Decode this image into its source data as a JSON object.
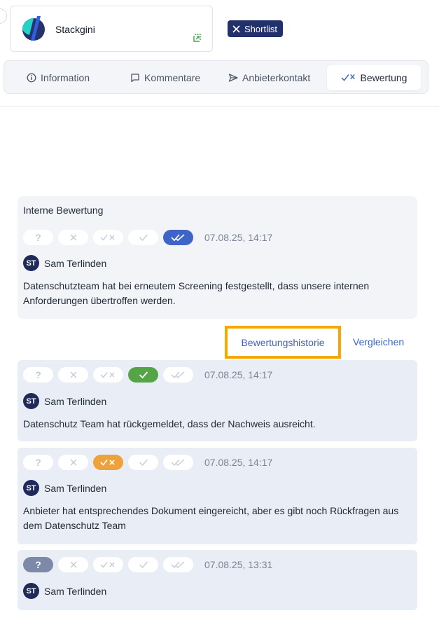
{
  "vendor": {
    "name": "Stackgini",
    "logo_icon": "stackgini-logo-icon",
    "corner_icon": "external-link-icon"
  },
  "shortlist_badge": {
    "label": "Shortlist",
    "icon": "close-icon"
  },
  "tabs": [
    {
      "label": "Information",
      "icon": "info-icon"
    },
    {
      "label": "Kommentare",
      "icon": "comment-icon"
    },
    {
      "label": "Anbieterkontakt",
      "icon": "send-icon"
    },
    {
      "label": "Bewertung",
      "icon": "check-x-icon",
      "active": true
    }
  ],
  "rating_scale": [
    "unknown",
    "rejected",
    "partially",
    "fulfilled",
    "exceeded"
  ],
  "internal_rating": {
    "title": "Interne Bewertung",
    "selected": "exceeded",
    "timestamp": "07.08.25, 14:17",
    "user": {
      "initials": "ST",
      "name": "Sam Terlinden"
    },
    "comment": "Datenschutzteam hat bei erneutem Screening festgestellt, dass unsere internen Anforderungen übertroffen werden."
  },
  "links": {
    "history": "Bewertungshistorie",
    "compare": "Vergleichen"
  },
  "history": [
    {
      "selected": "fulfilled",
      "timestamp": "07.08.25, 14:17",
      "user": {
        "initials": "ST",
        "name": "Sam Terlinden"
      },
      "comment": "Datenschutz Team hat rückgemeldet, dass der Nachweis ausreicht."
    },
    {
      "selected": "partially",
      "timestamp": "07.08.25, 14:17",
      "user": {
        "initials": "ST",
        "name": "Sam Terlinden"
      },
      "comment": "Anbieter hat entsprechendes Dokument eingereicht, aber es gibt noch Rückfragen aus dem Datenschutz Team"
    },
    {
      "selected": "unknown",
      "timestamp": "07.08.25, 13:31",
      "user": {
        "initials": "ST",
        "name": "Sam Terlinden"
      },
      "comment": ""
    }
  ],
  "colors": {
    "accent_blue": "#3f64c8",
    "fulfilled_green": "#55a546",
    "partial_orange": "#f0a23a",
    "unknown_grey": "#7c8aa8",
    "badge_navy": "#22306b",
    "highlight_orange": "#f5a800"
  }
}
